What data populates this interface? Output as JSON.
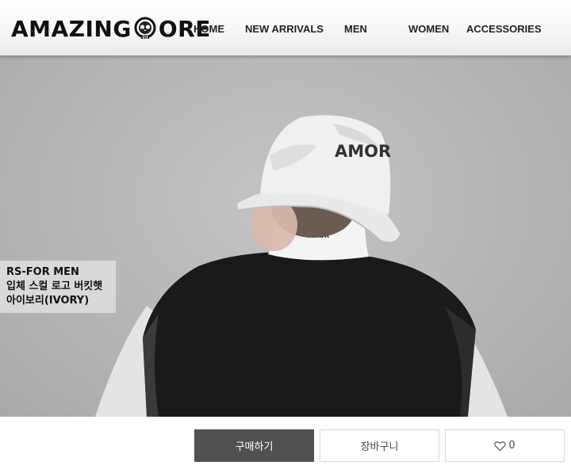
{
  "header": {
    "logo_left": "AMAZING",
    "logo_right": "ORE",
    "nav": [
      "HOME",
      "NEW ARRIVALS",
      "MEN",
      "WOMEN",
      "ACCESSORIES"
    ]
  },
  "hero": {
    "hat_logo": "AMOR",
    "collar_logo": "AMOR",
    "caption": [
      "RS-FOR MEN",
      "입체 스컬 로고 버킷햇",
      "아이보리(IVORY)"
    ]
  },
  "actions": {
    "buy_label": "구매하기",
    "cart_label": "장바구니",
    "like_count": "0"
  },
  "colors": {
    "buy_button": "#515151",
    "background": "#b8b8b8"
  }
}
